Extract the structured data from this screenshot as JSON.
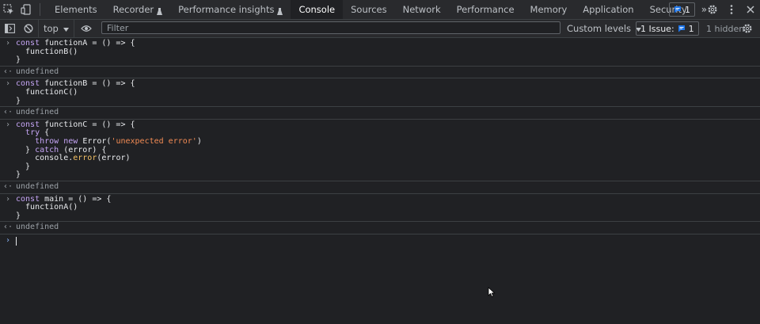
{
  "tabs": [
    {
      "label": "Elements",
      "active": false
    },
    {
      "label": "Recorder",
      "active": false,
      "experimental": true
    },
    {
      "label": "Performance insights",
      "active": false,
      "experimental": true
    },
    {
      "label": "Console",
      "active": true
    },
    {
      "label": "Sources",
      "active": false
    },
    {
      "label": "Network",
      "active": false
    },
    {
      "label": "Performance",
      "active": false
    },
    {
      "label": "Memory",
      "active": false
    },
    {
      "label": "Application",
      "active": false
    },
    {
      "label": "Security",
      "active": false
    }
  ],
  "overflow_label": "»",
  "messages_badge": "1",
  "toolbar": {
    "context": "top",
    "filter_placeholder": "Filter",
    "levels": "Custom levels",
    "issues_label": "1 Issue:",
    "issues_count": "1",
    "hidden": "1 hidden"
  },
  "console": {
    "entries": [
      {
        "lines": [
          [
            {
              "t": "const ",
              "c": "kw"
            },
            {
              "t": "functionA = () => {",
              "c": "fn"
            }
          ],
          [
            {
              "t": "  functionB()",
              "c": "fn"
            }
          ],
          [
            {
              "t": "}",
              "c": "fn"
            }
          ]
        ],
        "result": "undefined"
      },
      {
        "lines": [
          [
            {
              "t": "const ",
              "c": "kw"
            },
            {
              "t": "functionB = () => {",
              "c": "fn"
            }
          ],
          [
            {
              "t": "  functionC()",
              "c": "fn"
            }
          ],
          [
            {
              "t": "}",
              "c": "fn"
            }
          ]
        ],
        "result": "undefined"
      },
      {
        "lines": [
          [
            {
              "t": "const ",
              "c": "kw"
            },
            {
              "t": "functionC = () => {",
              "c": "fn"
            }
          ],
          [
            {
              "t": "  ",
              "c": "fn"
            },
            {
              "t": "try",
              "c": "kw"
            },
            {
              "t": " {",
              "c": "fn"
            }
          ],
          [
            {
              "t": "    ",
              "c": "fn"
            },
            {
              "t": "throw new ",
              "c": "kw"
            },
            {
              "t": "Error(",
              "c": "fn"
            },
            {
              "t": "'unexpected error'",
              "c": "str"
            },
            {
              "t": ")",
              "c": "fn"
            }
          ],
          [
            {
              "t": "  } ",
              "c": "fn"
            },
            {
              "t": "catch",
              "c": "kw"
            },
            {
              "t": " (error) {",
              "c": "fn"
            }
          ],
          [
            {
              "t": "    console.",
              "c": "fn"
            },
            {
              "t": "error",
              "c": "meth"
            },
            {
              "t": "(error)",
              "c": "fn"
            }
          ],
          [
            {
              "t": "  }",
              "c": "fn"
            }
          ],
          [
            {
              "t": "}",
              "c": "fn"
            }
          ]
        ],
        "result": "undefined"
      },
      {
        "lines": [
          [
            {
              "t": "const ",
              "c": "kw"
            },
            {
              "t": "main = () => {",
              "c": "fn"
            }
          ],
          [
            {
              "t": "  functionA()",
              "c": "fn"
            }
          ],
          [
            {
              "t": "}",
              "c": "fn"
            }
          ]
        ],
        "result": "undefined"
      }
    ]
  },
  "icons": {
    "inspect": "inspect-element-icon",
    "device": "device-toolbar-icon",
    "messages": "message-icon",
    "settings": "gear-icon",
    "more": "kebab-menu-icon",
    "close": "close-icon",
    "sidebar": "sidebar-toggle-icon",
    "clear": "clear-console-icon",
    "eye": "eye-icon"
  },
  "colors": {
    "accent": "#8ab4f8",
    "badge_blue": "#1a73e8",
    "keyword": "#c5a5f5",
    "string": "#f28b54",
    "method": "#f2c066"
  }
}
